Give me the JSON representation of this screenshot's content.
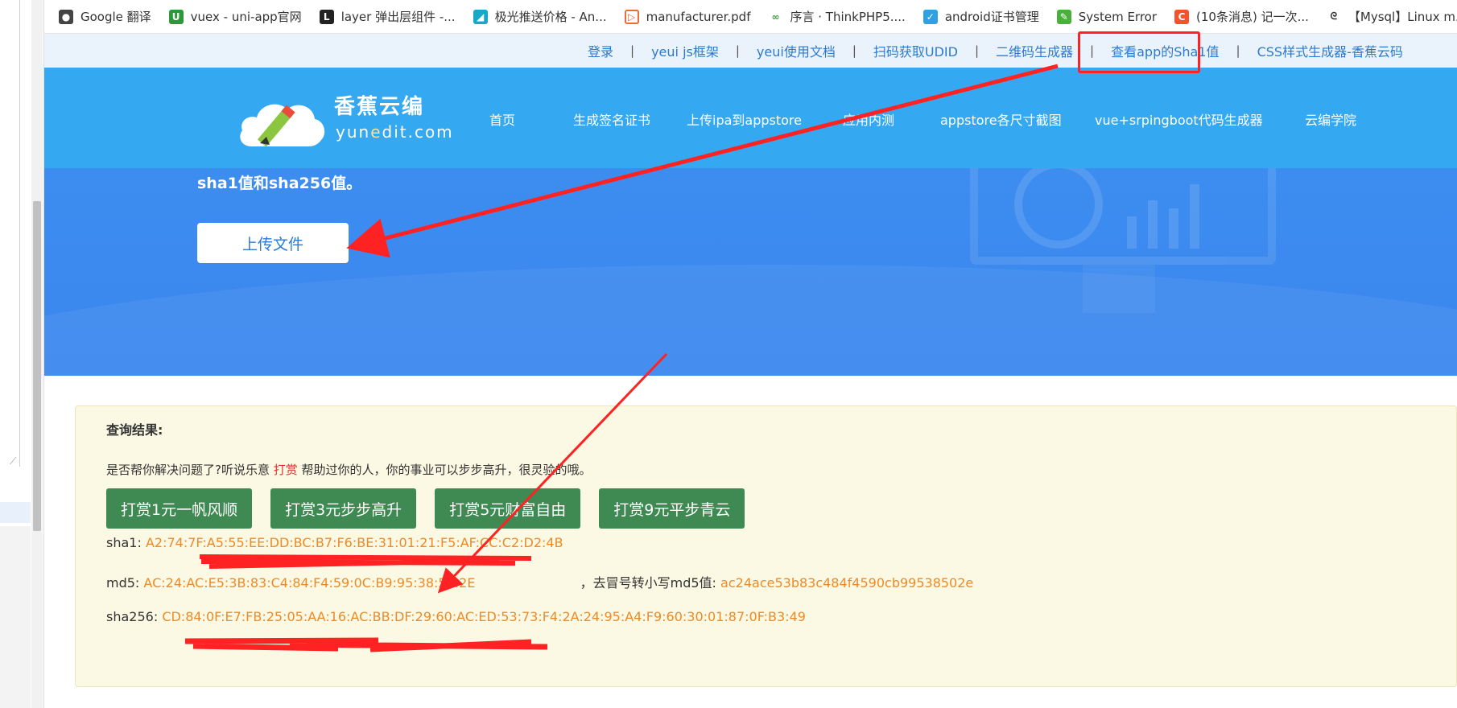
{
  "bookmarks": [
    {
      "label": "Google 翻译",
      "icon": "google-translate-icon",
      "color": "#555555"
    },
    {
      "label": "vuex - uni-app官网",
      "icon": "uniapp-icon",
      "color": "#2b9939"
    },
    {
      "label": "layer 弹出层组件 -...",
      "icon": "layer-icon",
      "color": "#222222"
    },
    {
      "label": "极光推送价格 - An...",
      "icon": "jiguang-icon",
      "color": "#16a9c7"
    },
    {
      "label": "manufacturer.pdf",
      "icon": "pdf-icon",
      "color": "#f06a35"
    },
    {
      "label": "序言 · ThinkPHP5....",
      "icon": "thinkphp-icon",
      "color": "#3a9a3a"
    },
    {
      "label": "android证书管理",
      "icon": "cert-icon",
      "color": "#2fa0e0"
    },
    {
      "label": "System Error",
      "icon": "feather-icon",
      "color": "#49b13b"
    },
    {
      "label": "(10条消息) 记一次...",
      "icon": "csdn-icon",
      "color": "#f4512c"
    },
    {
      "label": "【Mysql】Linux m...",
      "icon": "mysql-icon",
      "color": "#333333"
    }
  ],
  "toplinks": [
    "登录",
    "yeui js框架",
    "yeui使用文档",
    "扫码获取UDID",
    "二维码生成器",
    "查看app的Sha1值",
    "CSS样式生成器-香蕉云码"
  ],
  "logo": {
    "cn": "香蕉云编",
    "en_a": "yun",
    "en_hl": "e",
    "en_b": "dit.com"
  },
  "nav": [
    "首页",
    "生成签名证书",
    "上传ipa到appstore",
    "应用内测",
    "appstore各尺寸截图",
    "vue+srpingboot代码生成器",
    "云编学院"
  ],
  "hero": {
    "desc": "sha1值和sha256值。",
    "upload_label": "上传文件"
  },
  "result": {
    "title": "查询结果:",
    "thanks_a": "是否帮你解决问题了?听说乐意 ",
    "thanks_red": "打赏",
    "thanks_b": " 帮助过你的人，你的事业可以步步高升，很灵验的哦。",
    "rewards": [
      "打赏1元一帆风顺",
      "打赏3元步步高升",
      "打赏5元财富自由",
      "打赏9元平步青云"
    ],
    "sha1_label": "sha1:",
    "sha1_value": "A2:74:7F:A5:55:EE:DD:BC:B7:F6:BE:31:01:21:F5:AF:CC:C2:D2:4B",
    "md5_label": "md5:",
    "md5_value": "AC:24:AC:E5:3B:83:C4:84:F4:59:0C:B9:95:38:50:2E",
    "md5_lower_label": "，去冒号转小写md5值:",
    "md5_lower_value": "ac24ace53b83c484f4590cb99538502e",
    "sha256_label": "sha256:",
    "sha256_value": "CD:84:0F:E7:FB:25:05:AA:16:AC:BB:DF:29:60:AC:ED:53:73:F4:2A:24:95:A4:F9:60:30:01:87:0F:B3:49"
  },
  "colors": {
    "annotation_red": "#ff2222",
    "header_blue": "#34a8f0",
    "reward_green": "#3e8a52",
    "value_orange": "#ee8a25"
  }
}
